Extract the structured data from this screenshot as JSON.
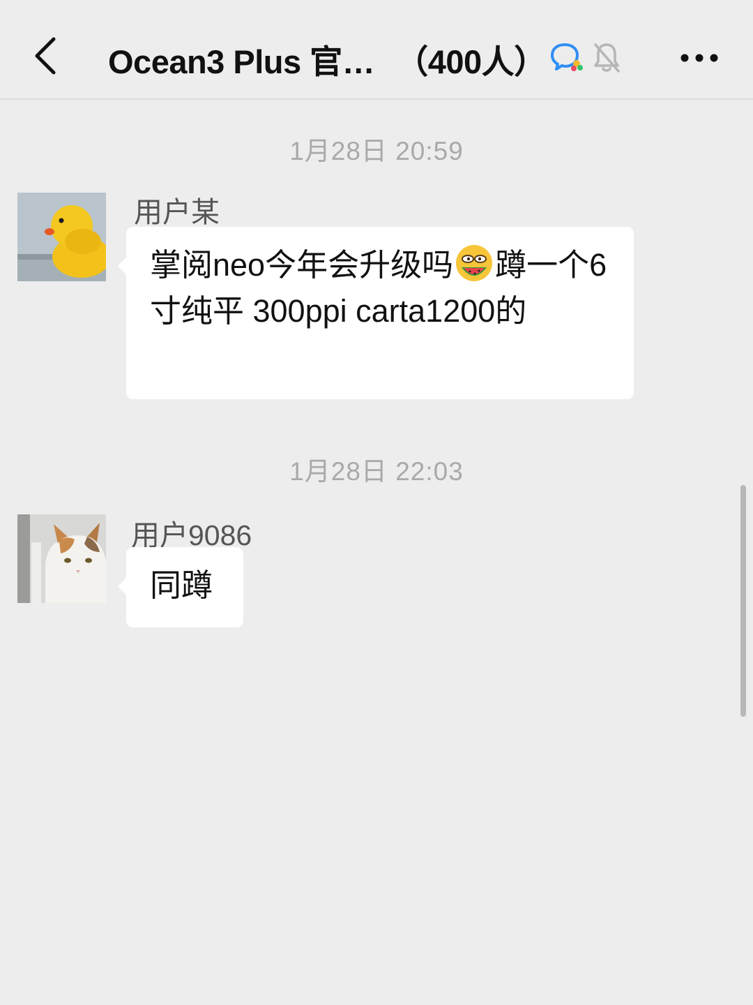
{
  "header": {
    "title": "Ocean3 Plus 官…",
    "member_count": "（400人）",
    "icons": {
      "back": "chevron-left-icon",
      "chat": "chat-bubble-icon",
      "mute": "bell-muted-icon",
      "more": "more-dots-icon"
    }
  },
  "messages": [
    {
      "timestamp": "1月28日 20:59",
      "sender": "用户某",
      "avatar": "rubber-duck-avatar",
      "text_part1": "掌阅neo今年会升级吗",
      "emoji": "watermelon-emoji",
      "text_part2": "蹲一个6寸纯平 300ppi carta1200的"
    },
    {
      "timestamp": "1月28日 22:03",
      "sender": "用户9086",
      "avatar": "cat-avatar",
      "text": "同蹲"
    }
  ],
  "colors": {
    "background": "#ededed",
    "bubble": "#ffffff",
    "timestamp": "#a9a9a9",
    "chat_icon_blue": "#2f8ef5"
  }
}
